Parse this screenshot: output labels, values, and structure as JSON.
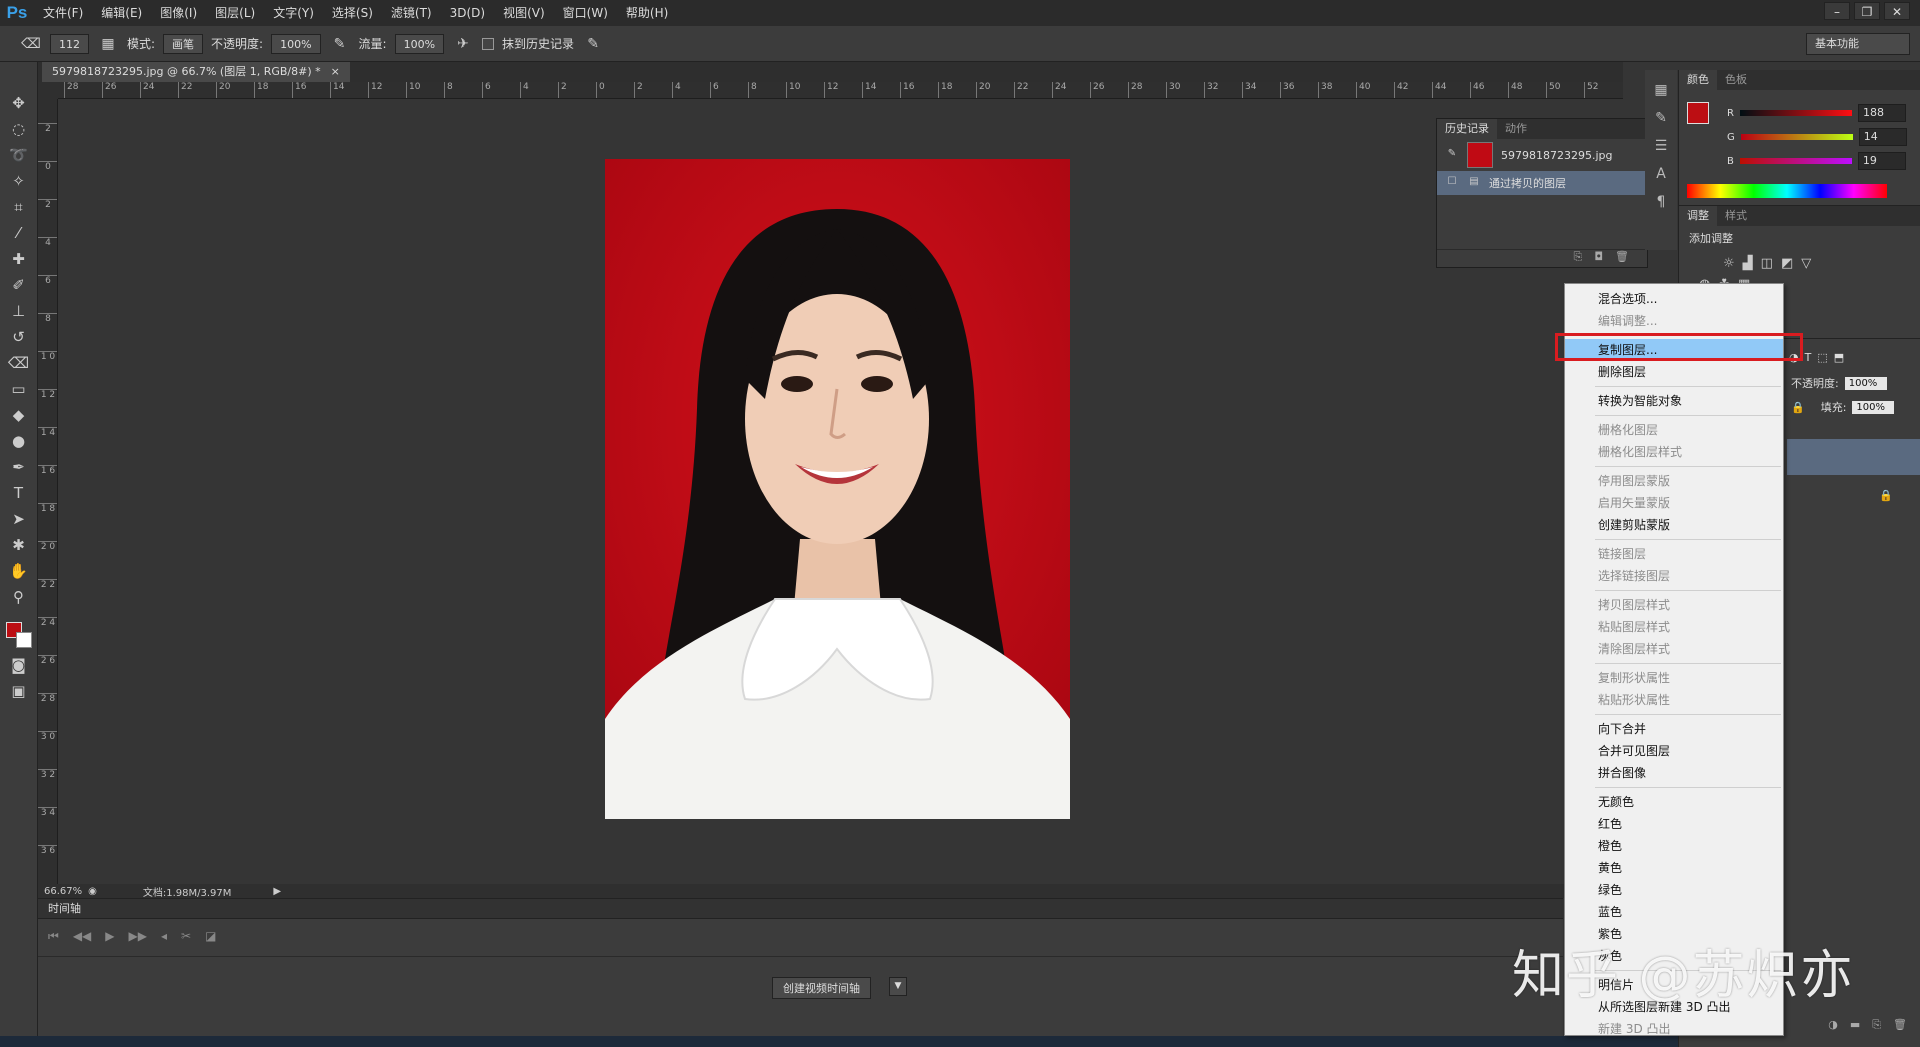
{
  "app": {
    "logo": "Ps"
  },
  "menu": [
    "文件(F)",
    "编辑(E)",
    "图像(I)",
    "图层(L)",
    "文字(Y)",
    "选择(S)",
    "滤镜(T)",
    "3D(D)",
    "视图(V)",
    "窗口(W)",
    "帮助(H)"
  ],
  "options": {
    "brush_size": "112",
    "mode_label": "模式:",
    "mode_value": "画笔",
    "opacity_label": "不透明度:",
    "opacity_value": "100%",
    "flow_label": "流量:",
    "flow_value": "100%",
    "erase_history_label": "抹到历史记录",
    "workspace": "基本功能"
  },
  "document": {
    "tab_title": "5979818723295.jpg @ 66.7% (图层 1, RGB/8#) *",
    "close": "×"
  },
  "ruler_h": [
    "28",
    "26",
    "24",
    "22",
    "20",
    "18",
    "16",
    "14",
    "12",
    "10",
    "8",
    "6",
    "4",
    "2",
    "0",
    "2",
    "4",
    "6",
    "8",
    "10",
    "12",
    "14",
    "16",
    "18",
    "20",
    "22",
    "24",
    "26",
    "28",
    "30",
    "32",
    "34",
    "36",
    "38",
    "40",
    "42",
    "44",
    "46",
    "48",
    "50",
    "52"
  ],
  "ruler_v": [
    "2",
    "0",
    "2",
    "4",
    "6",
    "8",
    "1 0",
    "1 2",
    "1 4",
    "1 6",
    "1 8",
    "2 0",
    "2 2",
    "2 4",
    "2 6",
    "2 8",
    "3 0",
    "3 2",
    "3 4",
    "3 6"
  ],
  "status": {
    "zoom": "66.67%",
    "doc_info": "文档:1.98M/3.97M"
  },
  "timeline": {
    "title": "时间轴",
    "create_button": "创建视频时间轴"
  },
  "history": {
    "tabs": [
      "历史记录",
      "动作"
    ],
    "rows": [
      {
        "label": "5979818723295.jpg"
      },
      {
        "label": "通过拷贝的图层"
      }
    ]
  },
  "color_panel": {
    "tabs": [
      "颜色",
      "色板"
    ],
    "r_label": "R",
    "r_value": "188",
    "g_label": "G",
    "g_value": "14",
    "b_label": "B",
    "b_value": "19",
    "fg_color": "#bc0e13"
  },
  "adjust_panel": {
    "tabs": [
      "调整",
      "样式"
    ],
    "title": "添加调整"
  },
  "layers_panel": {
    "opacity_label": "不透明度:",
    "opacity_value": "100%",
    "fill_label": "填充:",
    "fill_value": "100%"
  },
  "context_menu": {
    "groups": [
      [
        {
          "label": "混合选项...",
          "enabled": true
        },
        {
          "label": "编辑调整...",
          "enabled": false
        }
      ],
      [
        {
          "label": "复制图层...",
          "enabled": true,
          "highlighted": true
        },
        {
          "label": "删除图层",
          "enabled": true
        }
      ],
      [
        {
          "label": "转换为智能对象",
          "enabled": true
        }
      ],
      [
        {
          "label": "栅格化图层",
          "enabled": false
        },
        {
          "label": "栅格化图层样式",
          "enabled": false
        }
      ],
      [
        {
          "label": "停用图层蒙版",
          "enabled": false
        },
        {
          "label": "启用矢量蒙版",
          "enabled": false
        },
        {
          "label": "创建剪贴蒙版",
          "enabled": true
        }
      ],
      [
        {
          "label": "链接图层",
          "enabled": false
        },
        {
          "label": "选择链接图层",
          "enabled": false
        }
      ],
      [
        {
          "label": "拷贝图层样式",
          "enabled": false
        },
        {
          "label": "粘贴图层样式",
          "enabled": false
        },
        {
          "label": "清除图层样式",
          "enabled": false
        }
      ],
      [
        {
          "label": "复制形状属性",
          "enabled": false
        },
        {
          "label": "粘贴形状属性",
          "enabled": false
        }
      ],
      [
        {
          "label": "向下合并",
          "enabled": true
        },
        {
          "label": "合并可见图层",
          "enabled": true
        },
        {
          "label": "拼合图像",
          "enabled": true
        }
      ],
      [
        {
          "label": "无颜色",
          "enabled": true
        },
        {
          "label": "红色",
          "enabled": true
        },
        {
          "label": "橙色",
          "enabled": true
        },
        {
          "label": "黄色",
          "enabled": true
        },
        {
          "label": "绿色",
          "enabled": true
        },
        {
          "label": "蓝色",
          "enabled": true
        },
        {
          "label": "紫色",
          "enabled": true
        },
        {
          "label": "灰色",
          "enabled": true
        }
      ],
      [
        {
          "label": "明信片",
          "enabled": true
        },
        {
          "label": "从所选图层新建 3D 凸出",
          "enabled": true
        },
        {
          "label": "新建 3D 凸出",
          "enabled": false
        }
      ]
    ]
  },
  "watermark": "知乎 @苏炽亦",
  "colors": {
    "highlight_box": "#d91c20",
    "menu_highlight": "#91c9f7",
    "photo_bg": "#c00a14"
  }
}
